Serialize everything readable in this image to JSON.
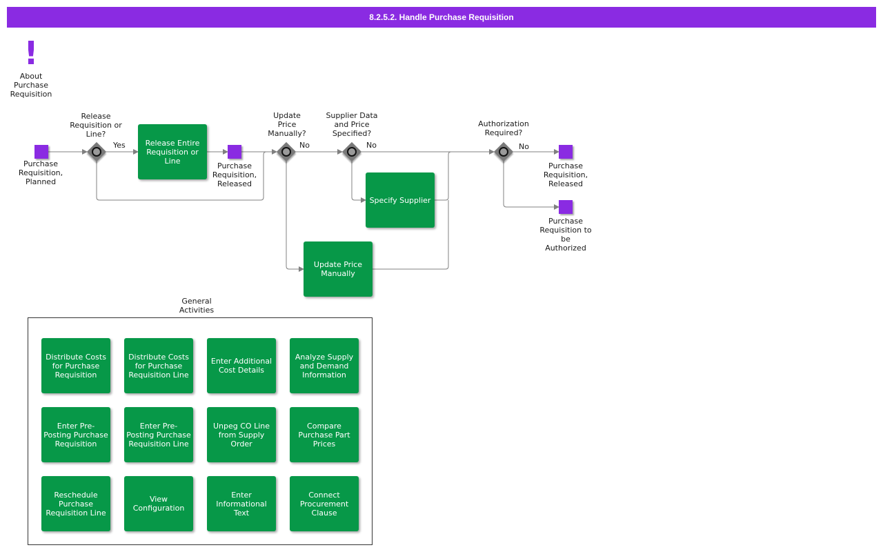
{
  "title": "8.2.5.2. Handle Purchase Requisition",
  "about": {
    "label": "About Purchase Requisition",
    "icon": "exclamation-icon"
  },
  "events": {
    "planned": "Purchase Requisition, Planned",
    "released_mid": "Purchase Requisition, Released",
    "released_end": "Purchase Requisition, Released",
    "to_authorize": "Purchase Requisition to be Authorized"
  },
  "gateways": {
    "release": "Release Requisition or Line?",
    "update_price": "Update Price Manually?",
    "supplier": "Supplier Data and Price Specified?",
    "authorization": "Authorization Required?"
  },
  "edge_labels": {
    "yes": "Yes",
    "no_update": "No",
    "no_supplier": "No",
    "no_auth": "No"
  },
  "tasks": {
    "release_entire": "Release Entire Requisition or Line",
    "specify_supplier": "Specify Supplier",
    "update_price": "Update Price Manually"
  },
  "general": {
    "title": "General Activities",
    "activities": [
      "Distribute Costs for Purchase Requisition",
      "Distribute Costs for Purchase Requisition Line",
      "Enter Additional Cost Details",
      "Analyze Supply and Demand Information",
      "Enter Pre-Posting Purchase Requisition",
      "Enter Pre-Posting Purchase Requisition Line",
      "Unpeg CO Line from Supply Order",
      "Compare Purchase Part Prices",
      "Reschedule Purchase Requisition Line",
      "View Configuration",
      "Enter Informational Text",
      "Connect Procurement Clause"
    ]
  },
  "colors": {
    "header": "#8a2be2",
    "event": "#8a2be2",
    "task": "#079848",
    "gateway": "#7a7a7a",
    "connector": "#808080"
  }
}
